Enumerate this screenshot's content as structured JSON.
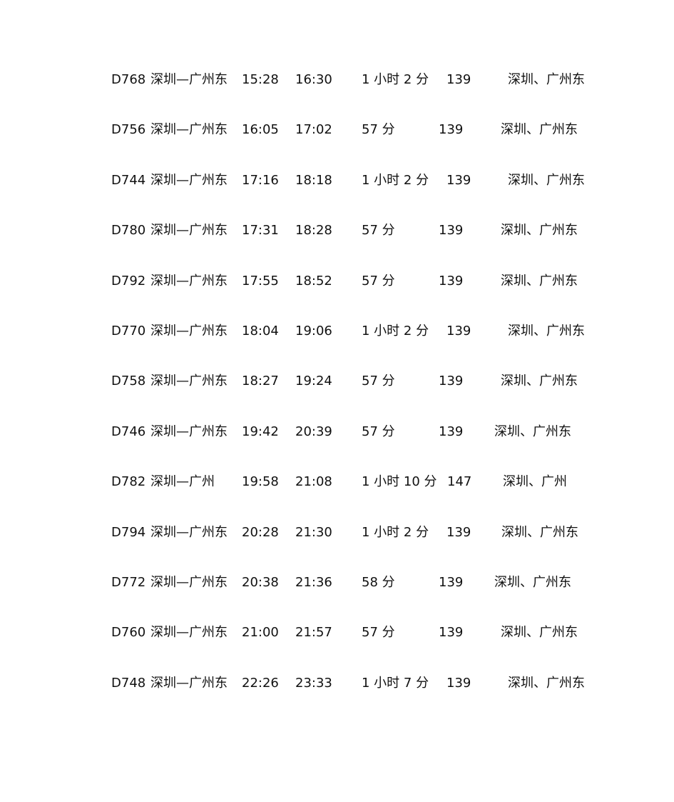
{
  "schedule": [
    {
      "train": "D768",
      "route": "深圳—广州东",
      "depart": "15:28",
      "arrive": "16:30",
      "duration": "1 小时 2 分",
      "price": "139",
      "stations": "深圳、广州东"
    },
    {
      "train": "D756",
      "route": "深圳—广州东",
      "depart": "16:05",
      "arrive": "17:02",
      "duration": "57 分",
      "price": "139",
      "stations": "深圳、广州东"
    },
    {
      "train": "D744",
      "route": "深圳—广州东",
      "depart": "17:16",
      "arrive": "18:18",
      "duration": "1 小时 2 分",
      "price": "139",
      "stations": "深圳、广州东"
    },
    {
      "train": "D780",
      "route": "深圳—广州东",
      "depart": "17:31",
      "arrive": "18:28",
      "duration": "57 分",
      "price": "139",
      "stations": "深圳、广州东"
    },
    {
      "train": "D792",
      "route": "深圳—广州东",
      "depart": "17:55",
      "arrive": "18:52",
      "duration": "57 分",
      "price": "139",
      "stations": "深圳、广州东"
    },
    {
      "train": "D770",
      "route": "深圳—广州东",
      "depart": "18:04",
      "arrive": "19:06",
      "duration": "1 小时 2 分",
      "price": "139",
      "stations": "深圳、广州东"
    },
    {
      "train": "D758",
      "route": "深圳—广州东",
      "depart": "18:27",
      "arrive": "19:24",
      "duration": "57 分",
      "price": "139",
      "stations": "深圳、广州东"
    },
    {
      "train": "D746",
      "route": "深圳—广州东",
      "depart": "19:42",
      "arrive": "20:39",
      "duration": "57 分",
      "price": "139",
      "stations": "深圳、广州东"
    },
    {
      "train": "D782",
      "route": "深圳—广州",
      "depart": "19:58",
      "arrive": "21:08",
      "duration": "1 小时 10 分",
      "price": "147",
      "stations": "深圳、广州"
    },
    {
      "train": "D794",
      "route": "深圳—广州东",
      "depart": "20:28",
      "arrive": "21:30",
      "duration": "1 小时 2 分",
      "price": "139",
      "stations": "深圳、广州东"
    },
    {
      "train": "D772",
      "route": "深圳—广州东",
      "depart": "20:38",
      "arrive": "21:36",
      "duration": "58 分",
      "price": "139",
      "stations": "深圳、广州东"
    },
    {
      "train": "D760",
      "route": "深圳—广州东",
      "depart": "21:00",
      "arrive": "21:57",
      "duration": "57 分",
      "price": "139",
      "stations": "深圳、广州东"
    },
    {
      "train": "D748",
      "route": "深圳—广州东",
      "depart": "22:26",
      "arrive": "23:33",
      "duration": "1 小时 7 分",
      "price": "139",
      "stations": "深圳、广州东"
    }
  ]
}
